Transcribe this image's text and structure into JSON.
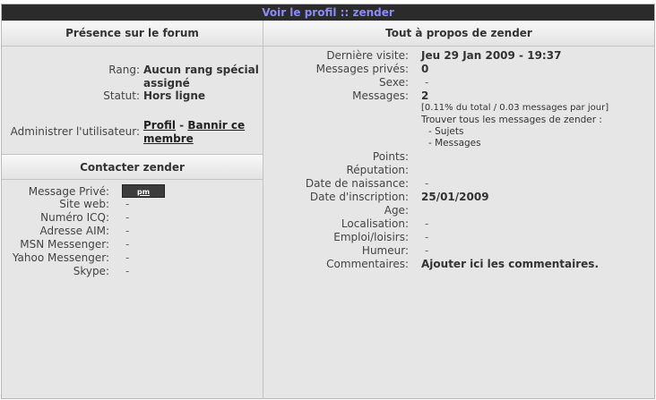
{
  "title": {
    "prefix": "Voir le profil",
    "separator": "::",
    "username": "zender"
  },
  "left": {
    "presence_header": "Présence sur le forum",
    "rank_label": "Rang:",
    "rank_value": "Aucun rang spécial assigné",
    "status_label": "Statut:",
    "status_value": "Hors ligne",
    "admin_label": "Administrer l'utilisateur:",
    "admin_profile_link": "Profil",
    "admin_sep": "-",
    "admin_ban_link": "Bannir ce membre",
    "contact_header": "Contacter zender",
    "contact": [
      {
        "label": "Message Privé:",
        "value": "pm",
        "is_button": true
      },
      {
        "label": "Site web:",
        "value": "-"
      },
      {
        "label": "Numéro ICQ:",
        "value": "-"
      },
      {
        "label": "Adresse AIM:",
        "value": "-"
      },
      {
        "label": "MSN Messenger:",
        "value": "-"
      },
      {
        "label": "Yahoo Messenger:",
        "value": "-"
      },
      {
        "label": "Skype:",
        "value": "-"
      }
    ]
  },
  "right": {
    "header": "Tout à propos de zender",
    "last_visit_label": "Dernière visite:",
    "last_visit_value": "Jeu 29 Jan 2009 - 19:37",
    "pm_label": "Messages privés:",
    "pm_value": "0",
    "sex_label": "Sexe:",
    "sex_value": "-",
    "posts_label": "Messages:",
    "posts_value": "2",
    "posts_stats": "[0.11% du total / 0.03 messages par jour]",
    "find_label": "Trouver tous les messages de zender :",
    "find_topics": "- Sujets",
    "find_messages": "- Messages",
    "points_label": "Points:",
    "reputation_label": "Réputation:",
    "birth_label": "Date de naissance:",
    "birth_value": "-",
    "joined_label": "Date d'inscription:",
    "joined_value": "25/01/2009",
    "age_label": "Age:",
    "location_label": "Localisation:",
    "location_value": "-",
    "job_label": "Emploi/loisirs:",
    "job_value": "-",
    "mood_label": "Humeur:",
    "mood_value": "-",
    "comments_label": "Commentaires:",
    "comments_value": "Ajouter ici les commentaires."
  }
}
